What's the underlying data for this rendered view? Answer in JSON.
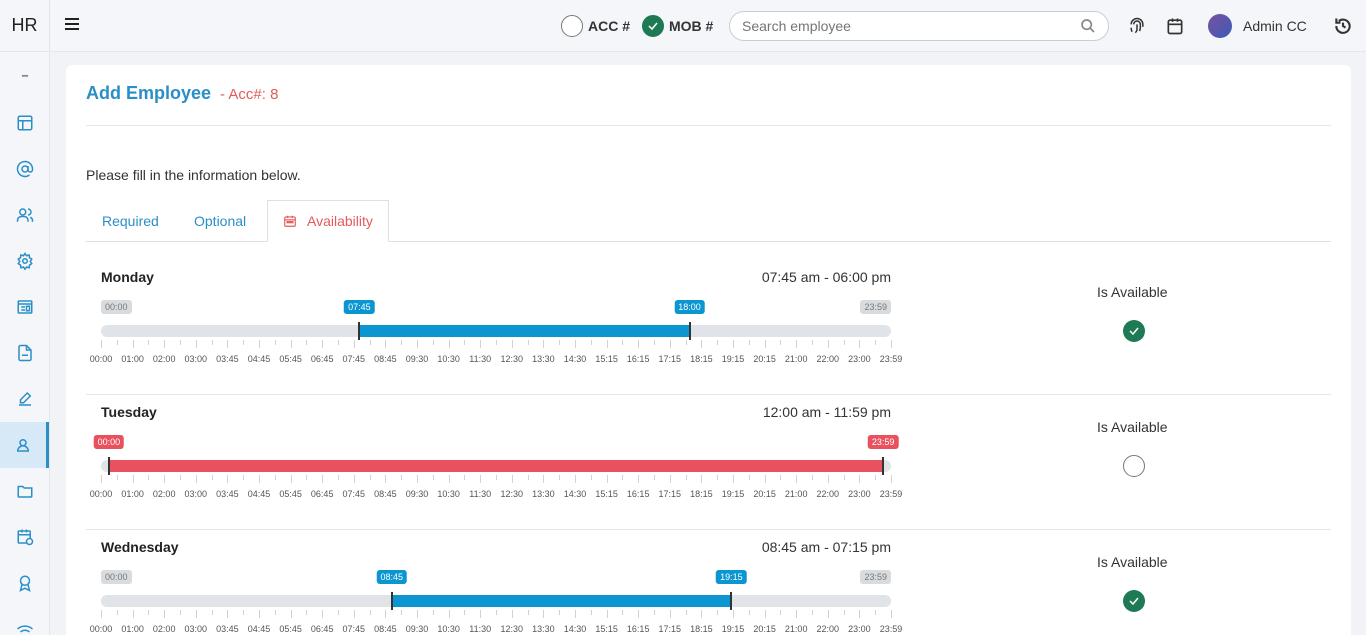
{
  "app": {
    "logo": "HR"
  },
  "topbar": {
    "acc_label": "ACC #",
    "mob_label": "MOB #",
    "acc_checked": false,
    "mob_checked": true,
    "search_placeholder": "Search employee",
    "user_name": "Admin CC"
  },
  "sidebar": {
    "items": [
      {
        "icon": "layout-icon"
      },
      {
        "icon": "at-icon"
      },
      {
        "icon": "users-icon"
      },
      {
        "icon": "gear-icon"
      },
      {
        "icon": "browser-icon"
      },
      {
        "icon": "document-icon"
      },
      {
        "icon": "pencil-icon"
      },
      {
        "icon": "user-badge-icon"
      },
      {
        "icon": "folder-icon"
      },
      {
        "icon": "calendar-clock-icon"
      },
      {
        "icon": "award-icon"
      },
      {
        "icon": "wifi-icon"
      }
    ]
  },
  "page": {
    "title": "Add Employee",
    "acc": "- Acc#: 8",
    "intro": "Please fill in the information below.",
    "tabs": {
      "required": "Required",
      "optional": "Optional",
      "availability": "Availability"
    }
  },
  "scale_labels": [
    "00:00",
    "01:00",
    "02:00",
    "03:00",
    "03:45",
    "04:45",
    "05:45",
    "06:45",
    "07:45",
    "08:45",
    "09:30",
    "10:30",
    "11:30",
    "12:30",
    "13:30",
    "14:30",
    "15:15",
    "16:15",
    "17:15",
    "18:15",
    "19:15",
    "20:15",
    "21:00",
    "22:00",
    "23:00",
    "23:59"
  ],
  "availability_label": "Is Available",
  "days": [
    {
      "name": "Monday",
      "range": "07:45 am - 06:00 pm",
      "start": "07:45",
      "end": "18:00",
      "start_pos": 0.327,
      "end_pos": 0.745,
      "min": "00:00",
      "max": "23:59",
      "color": "blue",
      "available": true
    },
    {
      "name": "Tuesday",
      "range": "12:00 am - 11:59 pm",
      "start": "00:00",
      "end": "23:59",
      "start_pos": 0.01,
      "end_pos": 0.99,
      "min": "",
      "max": "",
      "color": "red",
      "available": false
    },
    {
      "name": "Wednesday",
      "range": "08:45 am - 07:15 pm",
      "start": "08:45",
      "end": "19:15",
      "start_pos": 0.368,
      "end_pos": 0.798,
      "min": "00:00",
      "max": "23:59",
      "color": "blue",
      "available": true
    }
  ]
}
